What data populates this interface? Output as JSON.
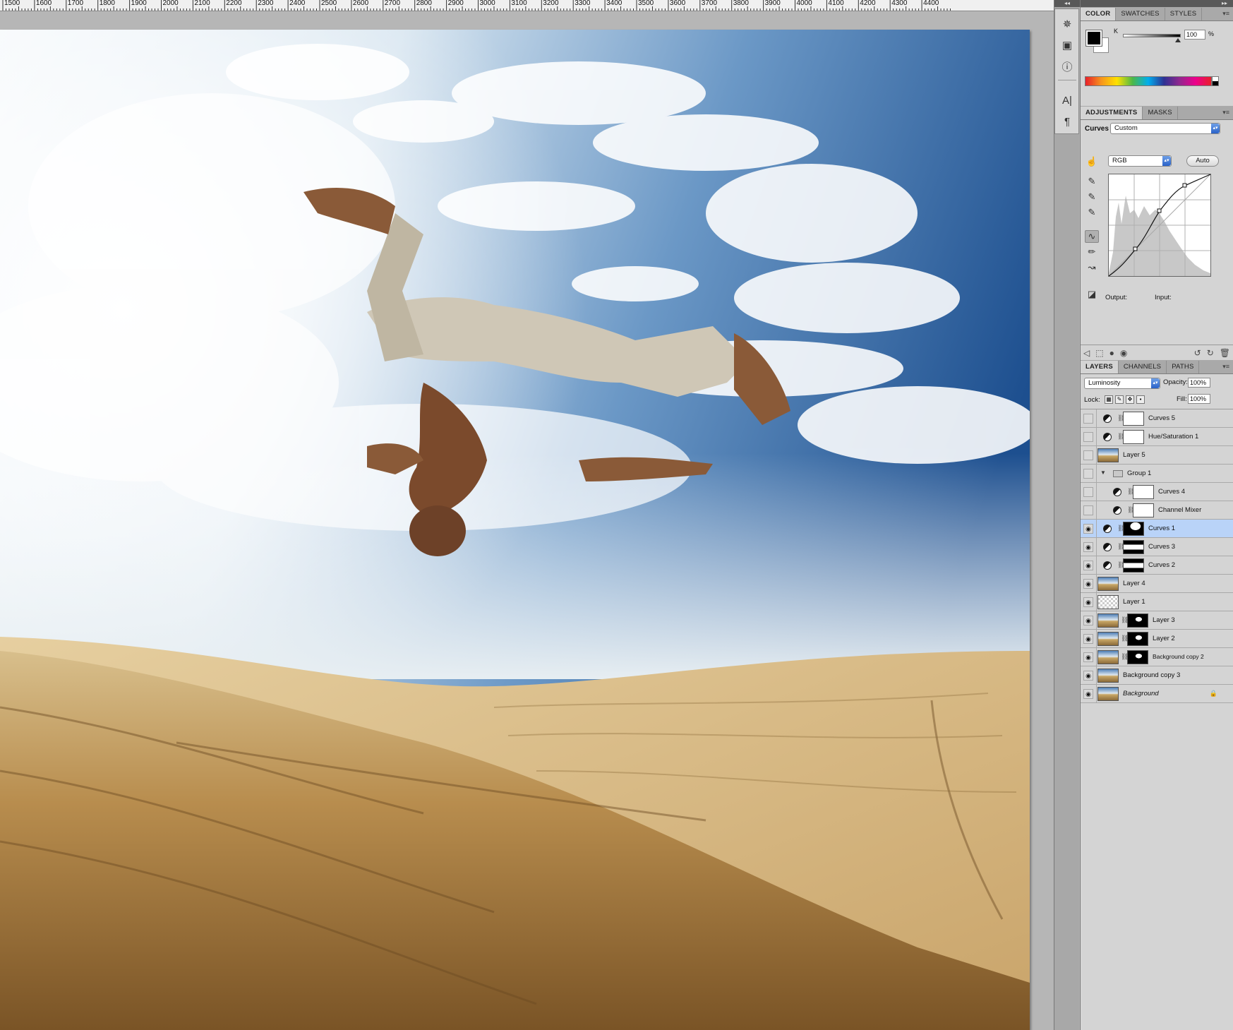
{
  "ruler": {
    "labels": [
      "1500",
      "1600",
      "1700",
      "1800",
      "1900",
      "2000",
      "2100",
      "2200",
      "2300",
      "2400",
      "2500",
      "2600",
      "2700",
      "2800",
      "2900",
      "3000",
      "3100",
      "3200",
      "3300",
      "3400",
      "3500",
      "3600",
      "3700",
      "3800",
      "3900",
      "4000",
      "4100",
      "4200",
      "4300",
      "4400"
    ]
  },
  "collapse": {
    "arrows": "◂◂"
  },
  "panels_top": {
    "arrows": "▸▸"
  },
  "color_panel": {
    "tabs": [
      "COLOR",
      "SWATCHES",
      "STYLES"
    ],
    "channel_label": "K",
    "channel_value": "100",
    "percent": "%",
    "k_level": 1.0
  },
  "adjustments": {
    "tabs": [
      "ADJUSTMENTS",
      "MASKS"
    ],
    "curves_label": "Curves",
    "preset": "Custom",
    "channel": "RGB",
    "auto_button": "Auto",
    "output_label": "Output:",
    "input_label": "Input:"
  },
  "layers": {
    "tabs": [
      "LAYERS",
      "CHANNELS",
      "PATHS"
    ],
    "blend_mode": "Luminosity",
    "opacity_label": "Opacity:",
    "opacity_value": "100%",
    "lock_label": "Lock:",
    "fill_label": "Fill:",
    "fill_value": "100%",
    "rows": [
      {
        "name": "Curves 5",
        "visible": false
      },
      {
        "name": "Hue/Saturation 1",
        "visible": false
      },
      {
        "name": "Layer 5",
        "visible": false
      },
      {
        "name": "Group 1",
        "visible": false
      },
      {
        "name": "Curves 4",
        "visible": false
      },
      {
        "name": "Channel Mixer",
        "visible": false
      },
      {
        "name": "Curves 1",
        "visible": true,
        "selected": true
      },
      {
        "name": "Curves 3",
        "visible": true
      },
      {
        "name": "Curves 2",
        "visible": true
      },
      {
        "name": "Layer 4",
        "visible": true
      },
      {
        "name": "Layer 1",
        "visible": true
      },
      {
        "name": "Layer 3",
        "visible": true
      },
      {
        "name": "Layer 2",
        "visible": true
      },
      {
        "name": "Background copy 2",
        "visible": true
      },
      {
        "name": "Background copy 3",
        "visible": true
      },
      {
        "name": "Background",
        "visible": true,
        "locked": true
      }
    ]
  },
  "icons": {
    "dock": [
      "compass-icon",
      "image-icon",
      "info-icon",
      "character-icon",
      "paragraph-icon"
    ],
    "accent": "#2a62c8",
    "selection": "#b9d3f8"
  }
}
